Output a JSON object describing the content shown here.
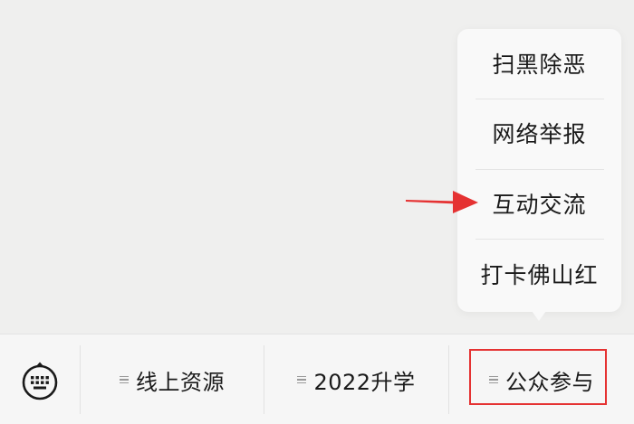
{
  "popup_menu": {
    "items": [
      {
        "label": "扫黑除恶"
      },
      {
        "label": "网络举报"
      },
      {
        "label": "互动交流"
      },
      {
        "label": "打卡佛山红"
      }
    ]
  },
  "bottom_bar": {
    "tabs": [
      {
        "label": "线上资源"
      },
      {
        "label": "2022升学"
      },
      {
        "label": "公众参与"
      }
    ]
  },
  "colors": {
    "annotation_red": "#e53232",
    "background": "#efefee"
  },
  "icons": {
    "keyboard": "keyboard-icon",
    "menu": "menu-lines-icon",
    "arrow": "red-arrow"
  }
}
